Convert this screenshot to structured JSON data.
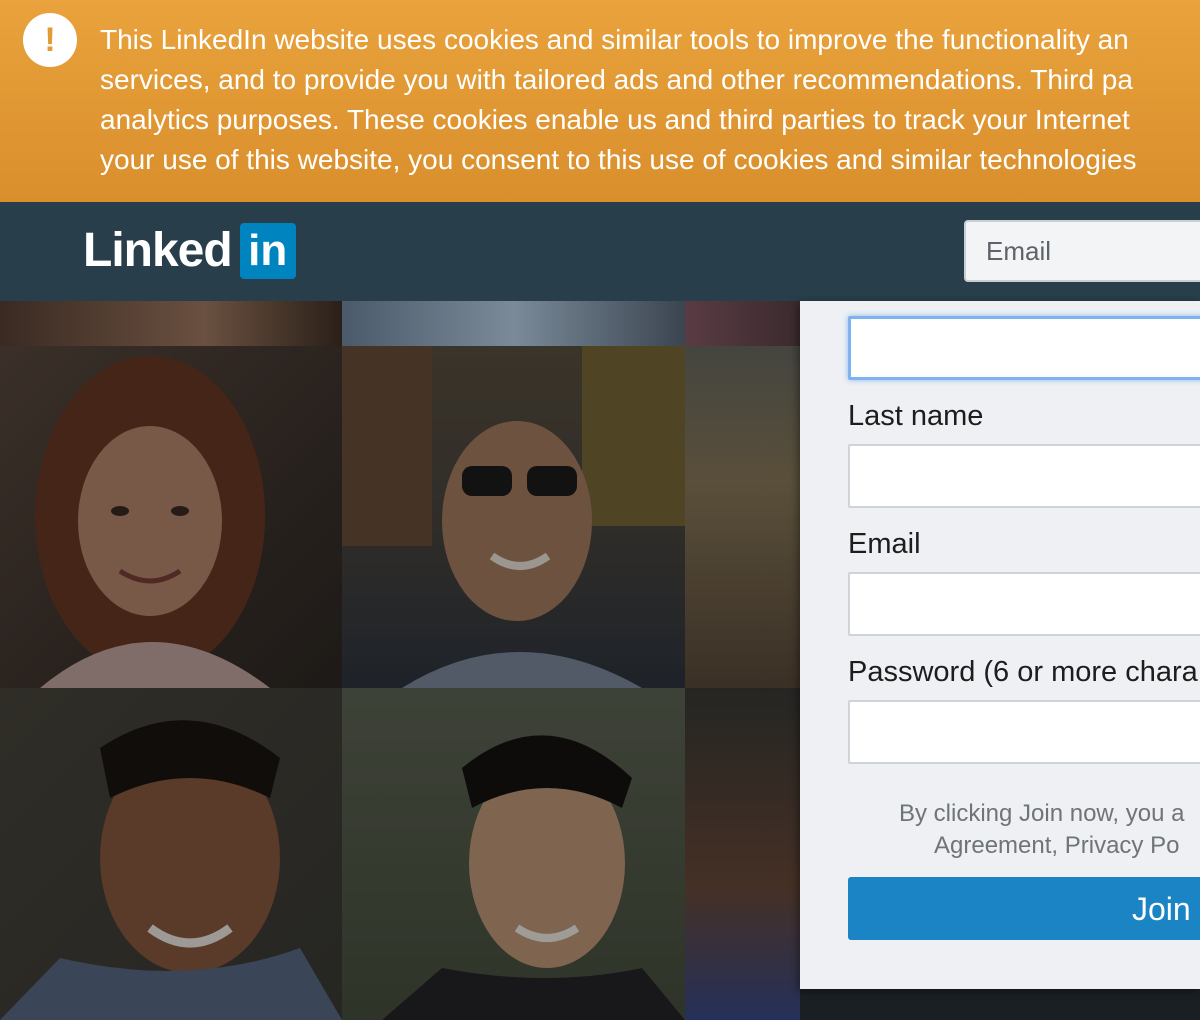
{
  "cookie_banner": {
    "icon": "exclamation-icon",
    "lines": [
      "This LinkedIn website uses cookies and similar tools to improve the functionality an",
      "services, and to provide you with tailored ads and other recommendations. Third pa",
      "analytics purposes. These cookies enable us and third parties to track your Internet",
      "your use of this website, you consent to this use of cookies and similar technologies"
    ]
  },
  "header": {
    "logo_word": "Linked",
    "logo_in": "in",
    "email_placeholder": "Email"
  },
  "signup": {
    "last_name_label": "Last name",
    "email_label": "Email",
    "password_label": "Password (6 or more chara",
    "agreement_lines": [
      "By clicking Join now, you a",
      "Agreement, Privacy Po"
    ],
    "join_label": "Join"
  },
  "colors": {
    "banner": "#e39b37",
    "header": "#283e4a",
    "brand_blue": "#0084bf",
    "join_button": "#1a84c4"
  }
}
